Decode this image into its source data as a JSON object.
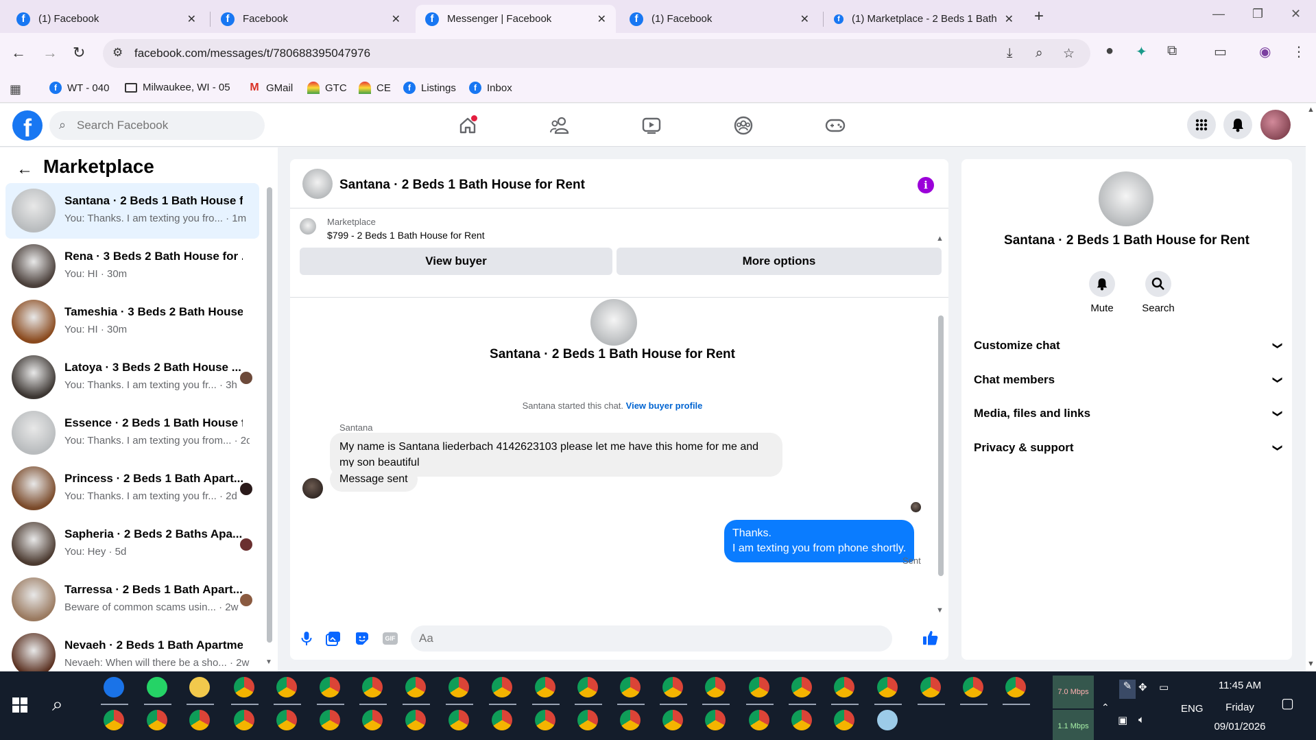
{
  "browser": {
    "tabs": [
      {
        "label": "(1) Facebook",
        "active": false
      },
      {
        "label": "Facebook",
        "active": false
      },
      {
        "label": "Messenger | Facebook",
        "active": true
      },
      {
        "label": "(1) Facebook",
        "active": false
      },
      {
        "label": "(1) Marketplace - 2 Beds 1 Bath",
        "active": false
      }
    ],
    "url": "facebook.com/messages/t/780688395047976",
    "bookmarks": [
      {
        "label": "WT - 040",
        "icon": "facebook-icon"
      },
      {
        "label": "Milwaukee, WI - 05",
        "icon": "folder-icon"
      },
      {
        "label": "GMail",
        "icon": "gmail-icon"
      },
      {
        "label": "GTC",
        "icon": "rainbow-icon"
      },
      {
        "label": "CE",
        "icon": "rainbow-icon"
      },
      {
        "label": "Listings",
        "icon": "facebook-icon"
      },
      {
        "label": "Inbox",
        "icon": "facebook-icon"
      }
    ]
  },
  "fb_header": {
    "search_placeholder": "Search Facebook",
    "nav_icons": [
      "home-icon",
      "friends-icon",
      "watch-icon",
      "groups-icon",
      "gaming-icon"
    ]
  },
  "sidebar": {
    "title": "Marketplace",
    "chats": [
      {
        "name": "Santana · 2 Beds 1 Bath House f...",
        "preview": "You: Thanks. I am texting you fro... · 1m",
        "selected": true,
        "thumb": "#b9bcbe",
        "mini": ""
      },
      {
        "name": "Rena · 3 Beds 2 Bath House for ...",
        "preview": "You: HI · 30m",
        "selected": false,
        "thumb": "#4a3f3a",
        "mini": ""
      },
      {
        "name": "Tameshia · 3 Beds 2 Bath House ...",
        "preview": "You: HI · 30m",
        "selected": false,
        "thumb": "#8a4a1e",
        "mini": ""
      },
      {
        "name": "Latoya · 3 Beds 2 Bath House ...",
        "preview": "You: Thanks. I am texting you fr... · 3h",
        "selected": false,
        "thumb": "#3c3632",
        "mini": "#6d4a3a"
      },
      {
        "name": "Essence · 2 Beds 1 Bath House f...",
        "preview": "You: Thanks. I am texting you from... · 2d",
        "selected": false,
        "thumb": "#b9bcbe",
        "mini": ""
      },
      {
        "name": "Princess · 2 Beds 1 Bath Apart...",
        "preview": "You: Thanks. I am texting you fr... · 2d",
        "selected": false,
        "thumb": "#7a4a2a",
        "mini": "#2a1a1a"
      },
      {
        "name": "Sapheria · 2 Beds 2 Baths Apa...",
        "preview": "You: Hey · 5d",
        "selected": false,
        "thumb": "#4b3a30",
        "mini": "#6a3030"
      },
      {
        "name": "Tarressa · 2 Beds 1 Bath Apart...",
        "preview": "Beware of common scams usin... · 2w",
        "selected": false,
        "thumb": "#9a7a60",
        "mini": "#8a5a40"
      },
      {
        "name": "Nevaeh · 2 Beds 1 Bath Apartme...",
        "preview": "Nevaeh: When will there be a sho... · 2w",
        "selected": false,
        "thumb": "#5a3020",
        "mini": ""
      }
    ]
  },
  "conversation": {
    "title": "Santana · 2 Beds 1 Bath House for Rent",
    "marketplace_label": "Marketplace",
    "listing": "$799 - 2 Beds 1 Bath House for Rent",
    "view_buyer_label": "View buyer",
    "more_options_label": "More options",
    "intro_name": "Santana · 2 Beds 1 Bath House for Rent",
    "started_text": "Santana started this chat.",
    "view_buyer_profile": "View buyer profile",
    "sender_name": "Santana",
    "incoming": [
      "My name is Santana liederbach  4142623103 please let me have this home for me and my son beautiful",
      "Message sent"
    ],
    "outgoing": "Thanks.\nI am texting you from phone shortly.",
    "status": "Sent",
    "composer_placeholder": "Aa"
  },
  "details": {
    "name": "Santana · 2 Beds 1 Bath House for Rent",
    "mute_label": "Mute",
    "search_label": "Search",
    "sections": [
      "Customize chat",
      "Chat members",
      "Media, files and links",
      "Privacy & support"
    ]
  },
  "taskbar": {
    "net_down": "7.0 Mbps",
    "net_up": "1.1 Mbps",
    "lang": "ENG",
    "time": "11:45 AM",
    "day": "Friday",
    "date": "09/01/2026"
  },
  "colors": {
    "fb_blue": "#1877f2",
    "outgoing_bubble": "#0a7cff",
    "selected_chat": "#e7f3ff",
    "info_purple": "#9b00d9"
  }
}
